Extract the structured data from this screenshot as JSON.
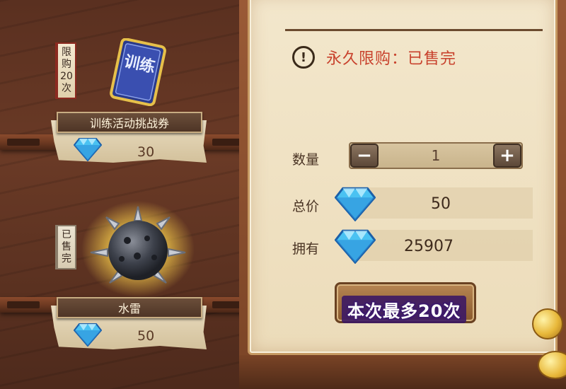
{
  "shop_items": [
    {
      "tag_label": "限购20次",
      "name": "训练活动挑战券",
      "price": "30",
      "icon": "training-ticket-icon",
      "icon_text": "训练"
    },
    {
      "tag_label": "已售完",
      "name": "水雷",
      "price": "50",
      "icon": "naval-mine-icon"
    }
  ],
  "purchase_panel": {
    "warning_icon": "exclamation-circle-icon",
    "warning_text": "永久限购：已售完",
    "quantity_label": "数量",
    "quantity_value": "1",
    "minus_label": "−",
    "plus_label": "+",
    "total_label": "总价",
    "total_value": "50",
    "owned_label": "拥有",
    "owned_value": "25907",
    "currency_icon": "diamond-icon",
    "buy_button_label": "本次最多20次"
  },
  "colors": {
    "warning_red": "#c8412c",
    "panel_parchment": "#f3e7cc",
    "button_overlay_purple": "#3d1a6a"
  }
}
